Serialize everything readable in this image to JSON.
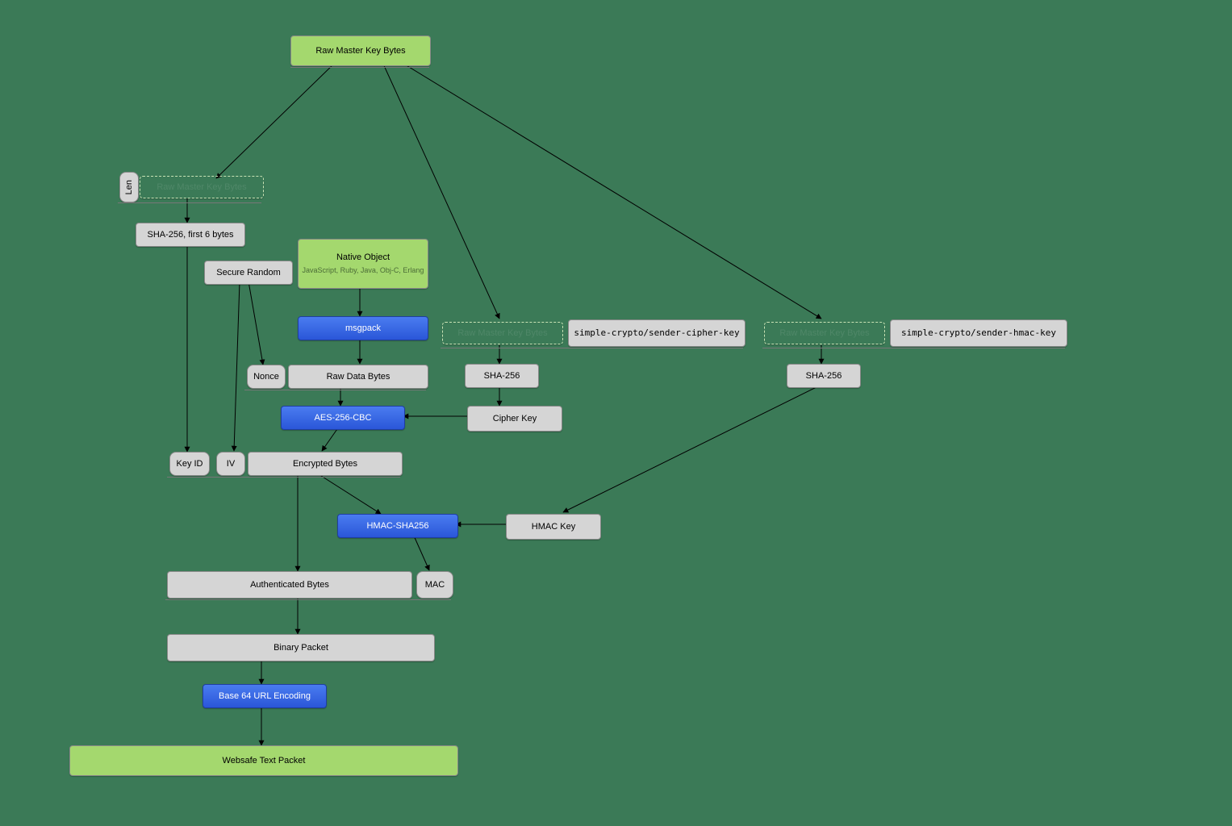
{
  "nodes": {
    "master": "Raw Master Key Bytes",
    "len": "Len",
    "ghost1": "Raw Master Key Bytes",
    "sha6": "SHA-256, first 6 bytes",
    "secure": "Secure Random",
    "native_title": "Native Object",
    "native_sub": "JavaScript, Ruby, Java, Obj-C, Erlang",
    "msgpack": "msgpack",
    "nonce": "Nonce",
    "raw_data": "Raw Data Bytes",
    "aes": "AES-256-CBC",
    "keyid": "Key ID",
    "iv": "IV",
    "enc": "Encrypted Bytes",
    "hmacsha": "HMAC-SHA256",
    "mac": "MAC",
    "auth": "Authenticated Bytes",
    "binary": "Binary Packet",
    "b64": "Base 64 URL Encoding",
    "websafe": "Websafe Text Packet",
    "ghost2": "Raw Master Key Bytes",
    "salt_cipher": "simple-crypto/sender-cipher-key",
    "sha_cipher": "SHA-256",
    "cipher_key": "Cipher Key",
    "ghost3": "Raw Master Key Bytes",
    "salt_hmac": "simple-crypto/sender-hmac-key",
    "sha_hmac": "SHA-256",
    "hmac_key": "HMAC Key"
  }
}
